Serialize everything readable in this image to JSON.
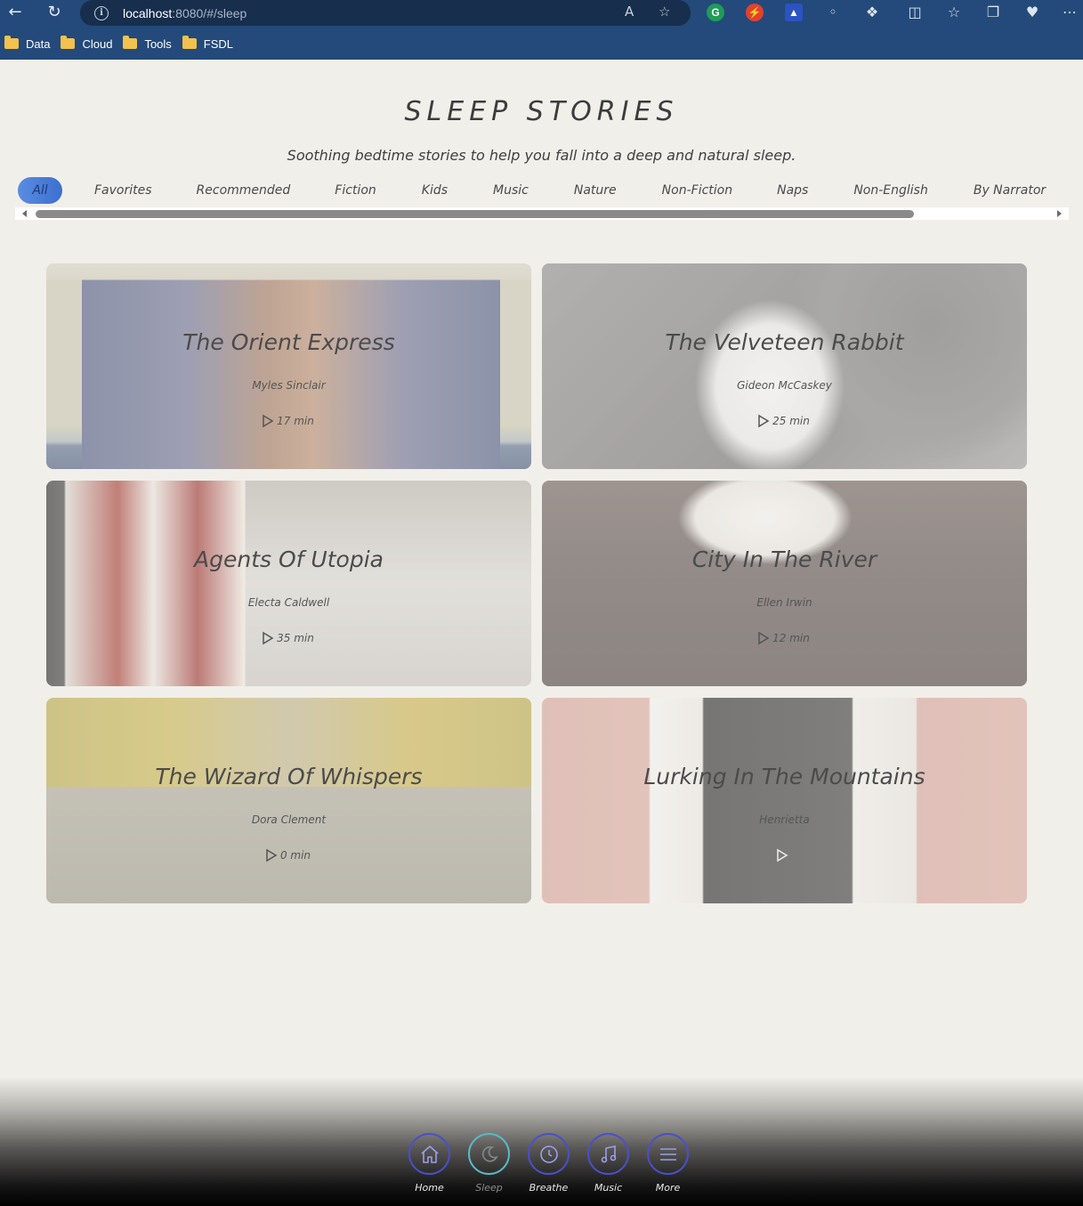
{
  "browser": {
    "url_host": "localhost",
    "url_rest": ":8080/#/sleep",
    "read_aloud": "A",
    "bookmarks": [
      {
        "label": "Data"
      },
      {
        "label": "Cloud"
      },
      {
        "label": "Tools"
      },
      {
        "label": "FSDL"
      }
    ]
  },
  "header": {
    "title": "SLEEP STORIES",
    "subtitle": "Soothing bedtime stories to help you fall into a deep and natural sleep."
  },
  "tabs": [
    {
      "label": "All",
      "active": true
    },
    {
      "label": "Favorites"
    },
    {
      "label": "Recommended"
    },
    {
      "label": "Fiction"
    },
    {
      "label": "Kids"
    },
    {
      "label": "Music"
    },
    {
      "label": "Nature"
    },
    {
      "label": "Non-Fiction"
    },
    {
      "label": "Naps"
    },
    {
      "label": "Non-English"
    },
    {
      "label": "By Narrator"
    }
  ],
  "stories": [
    {
      "title": "The Orient Express",
      "narrator": "Myles Sinclair",
      "duration": "17 min"
    },
    {
      "title": "The Velveteen Rabbit",
      "narrator": "Gideon McCaskey",
      "duration": "25 min"
    },
    {
      "title": "Agents Of Utopia",
      "narrator": "Electa Caldwell",
      "duration": "35 min"
    },
    {
      "title": "City In The River",
      "narrator": "Ellen Irwin",
      "duration": "12 min"
    },
    {
      "title": "The Wizard Of Whispers",
      "narrator": "Dora Clement",
      "duration": "0 min"
    },
    {
      "title": "Lurking In The Mountains",
      "narrator": "Henrietta",
      "duration": ""
    }
  ],
  "bottom_nav": [
    {
      "label": "Home",
      "icon": "home-icon"
    },
    {
      "label": "Sleep",
      "icon": "moon-icon",
      "active": true
    },
    {
      "label": "Breathe",
      "icon": "clock-icon"
    },
    {
      "label": "Music",
      "icon": "music-note-icon"
    },
    {
      "label": "More",
      "icon": "menu-icon"
    }
  ],
  "colors": {
    "browser_bar": "#234a7a",
    "tab_active": "#3d6fd0",
    "nav_ring": "#4a50c8",
    "nav_ring_active": "#5ab9c5",
    "page_bg": "#f1efea"
  }
}
